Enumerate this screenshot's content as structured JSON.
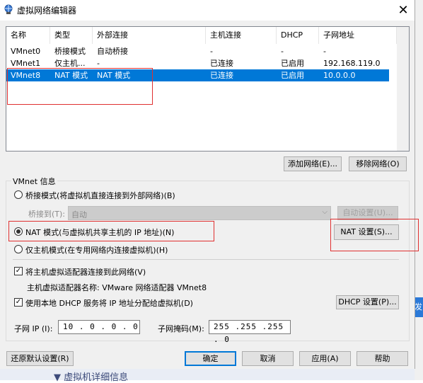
{
  "window": {
    "title": "虚拟网络编辑器",
    "close": "✕"
  },
  "table": {
    "headers": [
      "名称",
      "类型",
      "外部连接",
      "主机连接",
      "DHCP",
      "子网地址"
    ],
    "rows": [
      [
        "VMnet0",
        "桥接模式",
        "自动桥接",
        "-",
        "-",
        "-"
      ],
      [
        "VMnet1",
        "仅主机...",
        "-",
        "已连接",
        "已启用",
        "192.168.119.0"
      ],
      [
        "VMnet8",
        "NAT 模式",
        "NAT 模式",
        "已连接",
        "已启用",
        "10.0.0.0"
      ]
    ],
    "selected_index": 2
  },
  "buttons": {
    "add_network": "添加网络(E)...",
    "remove_network": "移除网络(O)",
    "auto_settings": "自动设置(U)...",
    "nat_settings": "NAT 设置(S)...",
    "dhcp_settings": "DHCP 设置(P)...",
    "restore_defaults": "还原默认设置(R)",
    "ok": "确定",
    "cancel": "取消",
    "apply": "应用(A)",
    "help": "帮助"
  },
  "vmnet_info": {
    "group_label": "VMnet 信息",
    "bridge_mode": "桥接模式(将虚拟机直接连接到外部网络)(B)",
    "bridge_to_label": "桥接到(T):",
    "bridge_to_value": "自动",
    "nat_mode": "NAT 模式(与虚拟机共享主机的 IP 地址)(N)",
    "host_only": "仅主机模式(在专用网络内连接虚拟机)(H)",
    "connect_adapter": "将主机虚拟适配器连接到此网络(V)",
    "adapter_name": "主机虚拟适配器名称: VMware 网络适配器 VMnet8",
    "use_dhcp": "使用本地 DHCP 服务将 IP 地址分配给虚拟机(D)",
    "subnet_ip_label": "子网 IP (I):",
    "subnet_ip_value": "10 . 0 . 0 . 0",
    "subnet_mask_label": "子网掩码(M):",
    "subnet_mask_value": "255 .255 .255 . 0",
    "selected_mode": "nat",
    "connect_adapter_checked": true,
    "use_dhcp_checked": true
  },
  "background": {
    "right_edge_text": "发",
    "bottom_text": "▼ 虚拟机详细信息"
  },
  "colors": {
    "selection": "#0078d7",
    "annotation_red": "#e03030"
  }
}
